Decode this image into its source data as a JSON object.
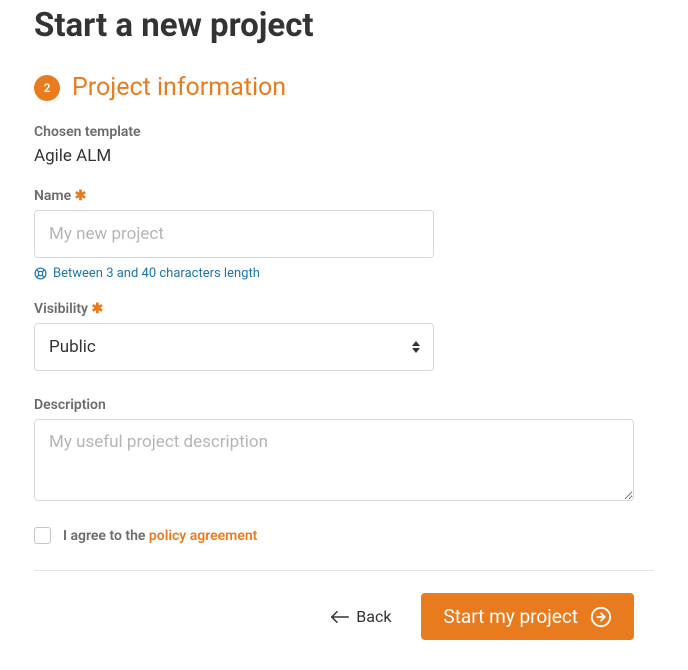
{
  "page": {
    "title": "Start a new project"
  },
  "step": {
    "number": "2",
    "title": "Project information"
  },
  "fields": {
    "template": {
      "label": "Chosen template",
      "value": "Agile ALM"
    },
    "name": {
      "label": "Name",
      "placeholder": "My new project",
      "hint": "Between 3 and 40 characters length"
    },
    "visibility": {
      "label": "Visibility",
      "value": "Public"
    },
    "description": {
      "label": "Description",
      "placeholder": "My useful project description"
    },
    "agreement": {
      "label_prefix": "I agree to the ",
      "link_text": "policy agreement"
    }
  },
  "actions": {
    "back": "Back",
    "submit": "Start my project"
  },
  "colors": {
    "accent": "#e87b1e",
    "hint": "#1f75a8"
  }
}
